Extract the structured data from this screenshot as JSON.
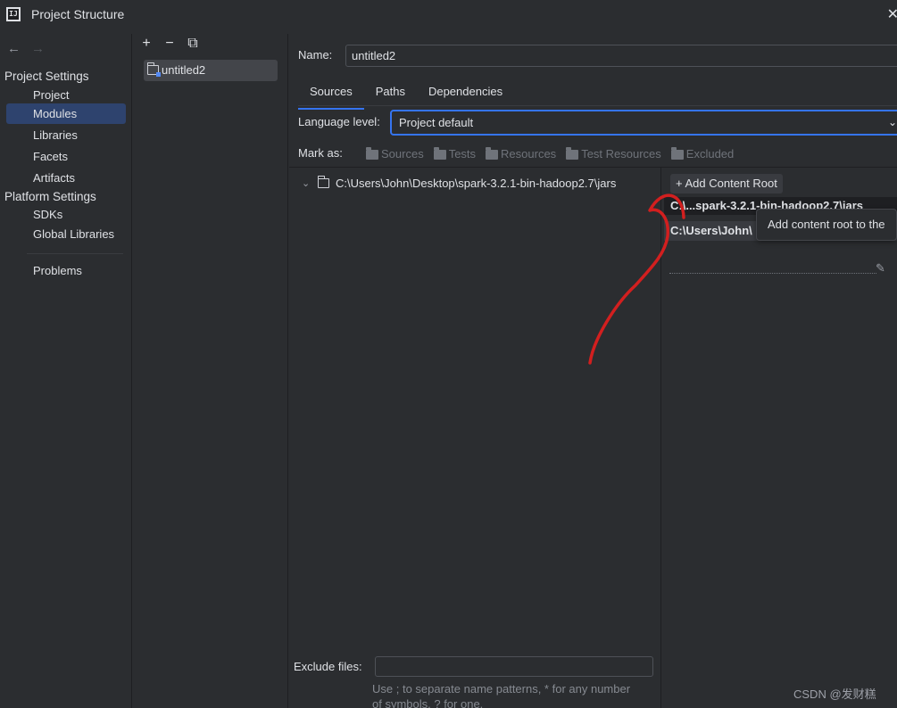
{
  "window": {
    "title": "Project Structure"
  },
  "left_nav": {
    "project_settings_header": "Project Settings",
    "project_items": [
      "Project",
      "Modules",
      "Libraries",
      "Facets",
      "Artifacts"
    ],
    "selected": "Modules",
    "platform_settings_header": "Platform Settings",
    "platform_items": [
      "SDKs",
      "Global Libraries"
    ],
    "problems": "Problems"
  },
  "modules": {
    "items": [
      "untitled2"
    ]
  },
  "main": {
    "name_label": "Name:",
    "name_value": "untitled2",
    "tabs": [
      "Sources",
      "Paths",
      "Dependencies"
    ],
    "active_tab": "Sources",
    "language_level_label": "Language level:",
    "language_level_value": "Project default",
    "mark_as_label": "Mark as:",
    "mark_as": [
      "Sources",
      "Tests",
      "Resources",
      "Test Resources",
      "Excluded"
    ],
    "tree_root": "C:\\Users\\John\\Desktop\\spark-3.2.1-bin-hadoop2.7\\jars",
    "add_content_root": "Add Content Root",
    "content_root_1": "C:\\...spark-3.2.1-bin-hadoop2.7\\jars",
    "content_root_2": "C:\\Users\\John\\",
    "tooltip": "Add content root to the",
    "exclude_files_label": "Exclude files:",
    "exclude_files_value": "",
    "exclude_hint": "Use ; to separate name patterns, * for any number of symbols, ? for one."
  },
  "watermark": "CSDN @发财糕",
  "colors": {
    "accent": "#3574f0",
    "selection": "#2e436e",
    "annotation": "#e02020"
  }
}
